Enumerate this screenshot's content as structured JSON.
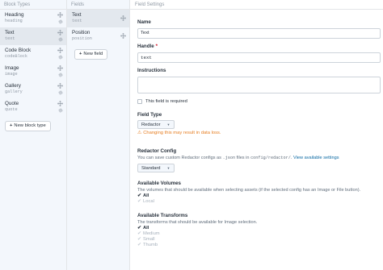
{
  "block_types": {
    "header": "Block Types",
    "items": [
      {
        "label": "Heading",
        "handle": "heading"
      },
      {
        "label": "Text",
        "handle": "text"
      },
      {
        "label": "Code Block",
        "handle": "codeBlock"
      },
      {
        "label": "Image",
        "handle": "image"
      },
      {
        "label": "Gallery",
        "handle": "gallery"
      },
      {
        "label": "Quote",
        "handle": "quote"
      }
    ],
    "new_button": "New block type"
  },
  "fields": {
    "header": "Fields",
    "items": [
      {
        "label": "Text",
        "handle": "text"
      },
      {
        "label": "Position",
        "handle": "position"
      }
    ],
    "new_button": "New field"
  },
  "field_settings": {
    "header": "Field Settings",
    "name_label": "Name",
    "name_value": "Text",
    "handle_label": "Handle",
    "handle_value": "text",
    "instructions_label": "Instructions",
    "required_label": "This field is required",
    "field_type_label": "Field Type",
    "field_type_value": "Redactor",
    "warning": "Changing this may result in data loss.",
    "redactor_config_label": "Redactor Config",
    "redactor_config_instructions_pre": "You can save custom Redactor configs as ",
    "redactor_config_instructions_code1": ".json",
    "redactor_config_instructions_mid": " files in ",
    "redactor_config_instructions_code2": "config/redactor/",
    "redactor_config_instructions_post": ".",
    "redactor_config_link": "View available settings",
    "redactor_config_value": "Standard",
    "volumes_label": "Available Volumes",
    "volumes_instructions": "The volumes that should be available when selecting assets (if the selected config has an Image or File button).",
    "volumes_options": [
      {
        "label": "All",
        "checked": true,
        "bold": true
      },
      {
        "label": "Local",
        "checked": true,
        "muted": true
      }
    ],
    "transforms_label": "Available Transforms",
    "transforms_instructions": "The transforms that should be available for Image selection.",
    "transforms_options": [
      {
        "label": "All",
        "checked": true,
        "bold": true
      },
      {
        "label": "Medium",
        "checked": true,
        "muted": true
      },
      {
        "label": "Small",
        "checked": true,
        "muted": true
      },
      {
        "label": "Thumb",
        "checked": true,
        "muted": true
      }
    ]
  },
  "colors": {
    "sidebar_bg": "#f3f7fc",
    "selected_bg": "#e3e8ee",
    "warning": "#e67e22",
    "link": "#0b69a3",
    "required": "#cf1124"
  },
  "icons": [
    "move-icon",
    "gear-icon",
    "plus-icon",
    "caret-down-icon",
    "warning-icon",
    "checkmark-icon"
  ]
}
